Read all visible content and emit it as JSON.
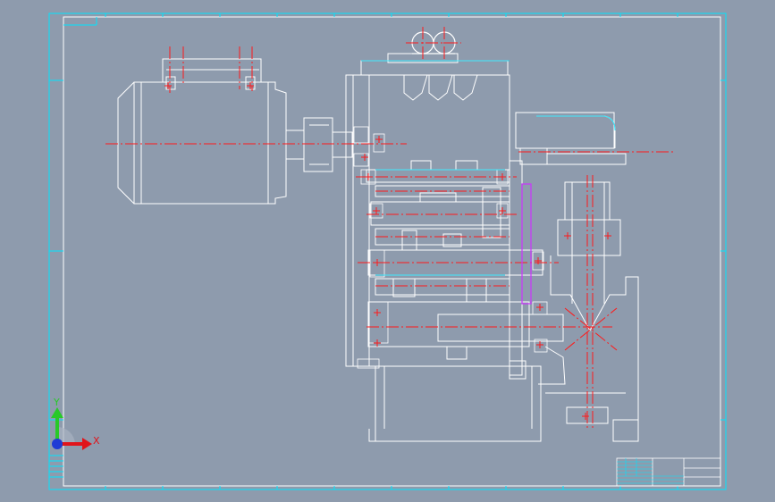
{
  "viewport": {
    "background": "#8e9bad",
    "colors": {
      "frame": "#00e5ff",
      "lines": "#ffffff",
      "centerlines": "#ff1a1a",
      "highlight": "#cc33ff",
      "axis_x": "#e0141b",
      "axis_y": "#28c928",
      "axis_z": "#1f3bd6"
    }
  },
  "triad": {
    "x_label": "X",
    "y_label": "Y"
  }
}
